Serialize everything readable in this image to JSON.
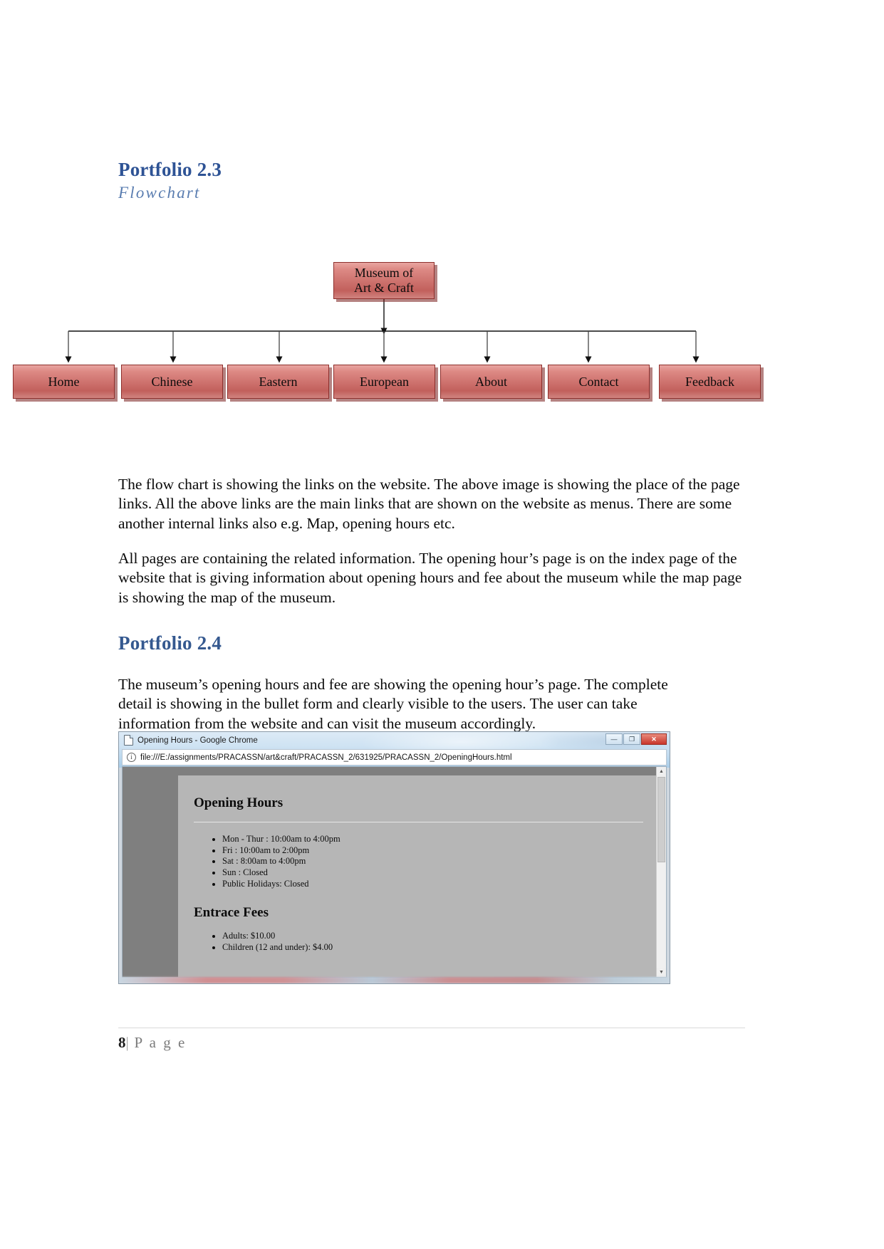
{
  "document": {
    "heading_23": "Portfolio 2.3",
    "subheading": "Flowchart",
    "heading_24": "Portfolio 2.4",
    "paragraph_1": "The flow chart is showing the links on the website. The above image is showing the place of the page links. All the above links are the main links that are shown on the website as menus. There are some another internal links also e.g. Map, opening hours etc.",
    "paragraph_2": "All pages are containing the related information. The opening hour’s page is on the index page of the website that is giving information about opening hours and fee about the museum while the map page is showing the map of the museum.",
    "paragraph_3": "The museum’s opening hours and fee are showing the opening hour’s page. The complete detail is showing in the bullet form and clearly visible to the users. The user can take information from the website and can visit the museum accordingly."
  },
  "flowchart": {
    "root": {
      "line1": "Museum of",
      "line2": "Art & Craft"
    },
    "nodes": [
      {
        "label": "Home"
      },
      {
        "label": "Chinese"
      },
      {
        "label": "Eastern"
      },
      {
        "label": "European"
      },
      {
        "label": "About"
      },
      {
        "label": "Contact"
      },
      {
        "label": "Feedback"
      }
    ],
    "box_fill": "#cc706c",
    "box_border": "#8d2f2c"
  },
  "browser_screenshot": {
    "window_title": "Opening Hours - Google Chrome",
    "url": "file:///E:/assignments/PRACASSN/art&craft/PRACASSN_2/631925/PRACASSN_2/OpeningHours.html",
    "window_buttons": {
      "minimize": "—",
      "maximize": "❐",
      "close": "✕"
    },
    "scrollbar": {
      "up_arrow": "▲",
      "down_arrow": "▼"
    },
    "webpage": {
      "heading_hours": "Opening Hours",
      "hours": [
        "Mon - Thur : 10:00am to 4:00pm",
        "Fri : 10:00am to 2:00pm",
        "Sat : 8:00am to 4:00pm",
        "Sun : Closed",
        "Public Holidays: Closed"
      ],
      "heading_fees": "Entrace Fees",
      "fees": [
        "Adults: $10.00",
        "Children (12 and under): $4.00"
      ]
    }
  },
  "footer": {
    "page_number": "8",
    "separator": "|",
    "label": "P a g e"
  }
}
